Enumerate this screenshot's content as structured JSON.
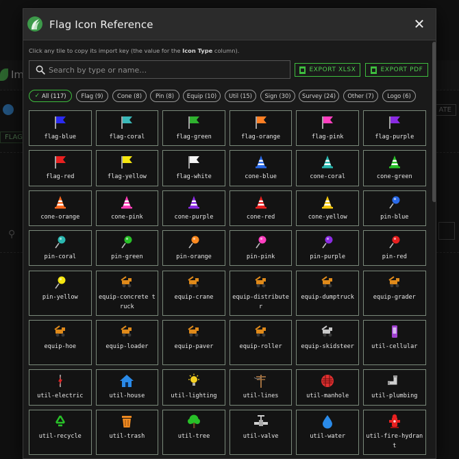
{
  "background": {
    "title_fragment": "Im",
    "flag_fragment": "FLAG",
    "right_button_fragment": "ATE"
  },
  "dialog": {
    "title": "Flag Icon Reference",
    "close_icon": "close-icon",
    "hint_prefix": "Click any tile to copy its import key (the value for the ",
    "hint_bold": "Icon Type",
    "hint_suffix": " column).",
    "search_placeholder": "Search by type or name…",
    "export_xlsx_label": "EXPORT XLSX",
    "export_pdf_label": "EXPORT PDF",
    "accent_color": "#3fbf3f"
  },
  "chips": [
    {
      "label": "All (117)",
      "active": true
    },
    {
      "label": "Flag (9)",
      "active": false
    },
    {
      "label": "Cone (8)",
      "active": false
    },
    {
      "label": "Pin (8)",
      "active": false
    },
    {
      "label": "Equip (10)",
      "active": false
    },
    {
      "label": "Util (15)",
      "active": false
    },
    {
      "label": "Sign (30)",
      "active": false
    },
    {
      "label": "Survey (24)",
      "active": false
    },
    {
      "label": "Other (7)",
      "active": false
    },
    {
      "label": "Logo (6)",
      "active": false
    }
  ],
  "tiles": [
    {
      "label": "flag-blue",
      "icon": "flag-icon",
      "color": "#2b2bf0"
    },
    {
      "label": "flag-coral",
      "icon": "flag-icon",
      "color": "#3ab8b8"
    },
    {
      "label": "flag-green",
      "icon": "flag-icon",
      "color": "#2fb12f"
    },
    {
      "label": "flag-orange",
      "icon": "flag-icon",
      "color": "#ff7f24"
    },
    {
      "label": "flag-pink",
      "icon": "flag-icon",
      "color": "#ff3fc0"
    },
    {
      "label": "flag-purple",
      "icon": "flag-icon",
      "color": "#8a2be2"
    },
    {
      "label": "flag-red",
      "icon": "flag-icon",
      "color": "#e82020"
    },
    {
      "label": "flag-yellow",
      "icon": "flag-icon",
      "color": "#f5e60f"
    },
    {
      "label": "flag-white",
      "icon": "flag-icon",
      "color": "#f4f4f4"
    },
    {
      "label": "cone-blue",
      "icon": "cone-icon",
      "color": "#2a6ae8"
    },
    {
      "label": "cone-coral",
      "icon": "cone-icon",
      "color": "#2ab8b0"
    },
    {
      "label": "cone-green",
      "icon": "cone-icon",
      "color": "#28c028"
    },
    {
      "label": "cone-orange",
      "icon": "cone-icon",
      "color": "#ff6a20"
    },
    {
      "label": "cone-pink",
      "icon": "cone-icon",
      "color": "#ff3fb8"
    },
    {
      "label": "cone-purple",
      "icon": "cone-icon",
      "color": "#8a2be2"
    },
    {
      "label": "cone-red",
      "icon": "cone-icon",
      "color": "#e82020"
    },
    {
      "label": "cone-yellow",
      "icon": "cone-icon",
      "color": "#f5c80f"
    },
    {
      "label": "pin-blue",
      "icon": "pushpin-icon",
      "color": "#2a6ae8"
    },
    {
      "label": "pin-coral",
      "icon": "pushpin-icon",
      "color": "#2ab8b0"
    },
    {
      "label": "pin-green",
      "icon": "pushpin-icon",
      "color": "#28c028"
    },
    {
      "label": "pin-orange",
      "icon": "pushpin-icon",
      "color": "#ff8a20"
    },
    {
      "label": "pin-pink",
      "icon": "pushpin-icon",
      "color": "#ff3fc0"
    },
    {
      "label": "pin-purple",
      "icon": "pushpin-icon",
      "color": "#8a2be2"
    },
    {
      "label": "pin-red",
      "icon": "pushpin-icon",
      "color": "#e82020"
    },
    {
      "label": "pin-yellow",
      "icon": "pushpin-icon",
      "color": "#f5e60f"
    },
    {
      "label": "equip-concrete truck",
      "icon": "concrete-truck-icon",
      "color": "#e08a1a"
    },
    {
      "label": "equip-crane",
      "icon": "crane-icon",
      "color": "#e08a1a"
    },
    {
      "label": "equip-distributer",
      "icon": "distributer-icon",
      "color": "#e08a1a"
    },
    {
      "label": "equip-dumptruck",
      "icon": "dumptruck-icon",
      "color": "#e08a1a"
    },
    {
      "label": "equip-grader",
      "icon": "grader-icon",
      "color": "#e08a1a"
    },
    {
      "label": "equip-hoe",
      "icon": "backhoe-icon",
      "color": "#e08a1a"
    },
    {
      "label": "equip-loader",
      "icon": "loader-icon",
      "color": "#e08a1a"
    },
    {
      "label": "equip-paver",
      "icon": "paver-icon",
      "color": "#e08a1a"
    },
    {
      "label": "equip-roller",
      "icon": "roller-icon",
      "color": "#e08a1a"
    },
    {
      "label": "equip-skidsteer",
      "icon": "skidsteer-icon",
      "color": "#c8c8c8"
    },
    {
      "label": "util-cellular",
      "icon": "cellular-icon",
      "color": "#a040d0"
    },
    {
      "label": "util-electric",
      "icon": "electric-icon",
      "color": "#e02020"
    },
    {
      "label": "util-house",
      "icon": "house-icon",
      "color": "#2a8ae8"
    },
    {
      "label": "util-lighting",
      "icon": "lightbulb-icon",
      "color": "#f5d020"
    },
    {
      "label": "util-lines",
      "icon": "utility-pole-icon",
      "color": "#a07040"
    },
    {
      "label": "util-manhole",
      "icon": "manhole-icon",
      "color": "#e03030"
    },
    {
      "label": "util-plumbing",
      "icon": "pipe-icon",
      "color": "#cfcfcf"
    },
    {
      "label": "util-recycle",
      "icon": "recycle-icon",
      "color": "#28c028"
    },
    {
      "label": "util-trash",
      "icon": "trash-icon",
      "color": "#f08a20"
    },
    {
      "label": "util-tree",
      "icon": "tree-icon",
      "color": "#28c028"
    },
    {
      "label": "util-valve",
      "icon": "valve-icon",
      "color": "#cfcfcf"
    },
    {
      "label": "util-water",
      "icon": "water-drop-icon",
      "color": "#2a8ae8"
    },
    {
      "label": "util-fire-hydrant",
      "icon": "fire-hydrant-icon",
      "color": "#e82020"
    }
  ]
}
